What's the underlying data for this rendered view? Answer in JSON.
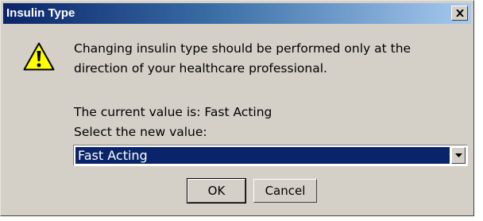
{
  "dialog": {
    "title": "Insulin Type",
    "close_glyph": "×",
    "icon": "warning-icon",
    "message": "Changing insulin type should be performed only at the direction of your healthcare professional.",
    "current_value_text": "The current value is: Fast Acting",
    "select_label": "Select the new value:",
    "selected_value": "Fast Acting",
    "ok_label": "OK",
    "cancel_label": "Cancel"
  },
  "colors": {
    "title_bar_start": "#0a246a",
    "title_bar_end": "#a6caf0",
    "dialog_background": "#d4d0c8",
    "selection": "#0a246a",
    "warning_yellow": "#ffff00"
  }
}
